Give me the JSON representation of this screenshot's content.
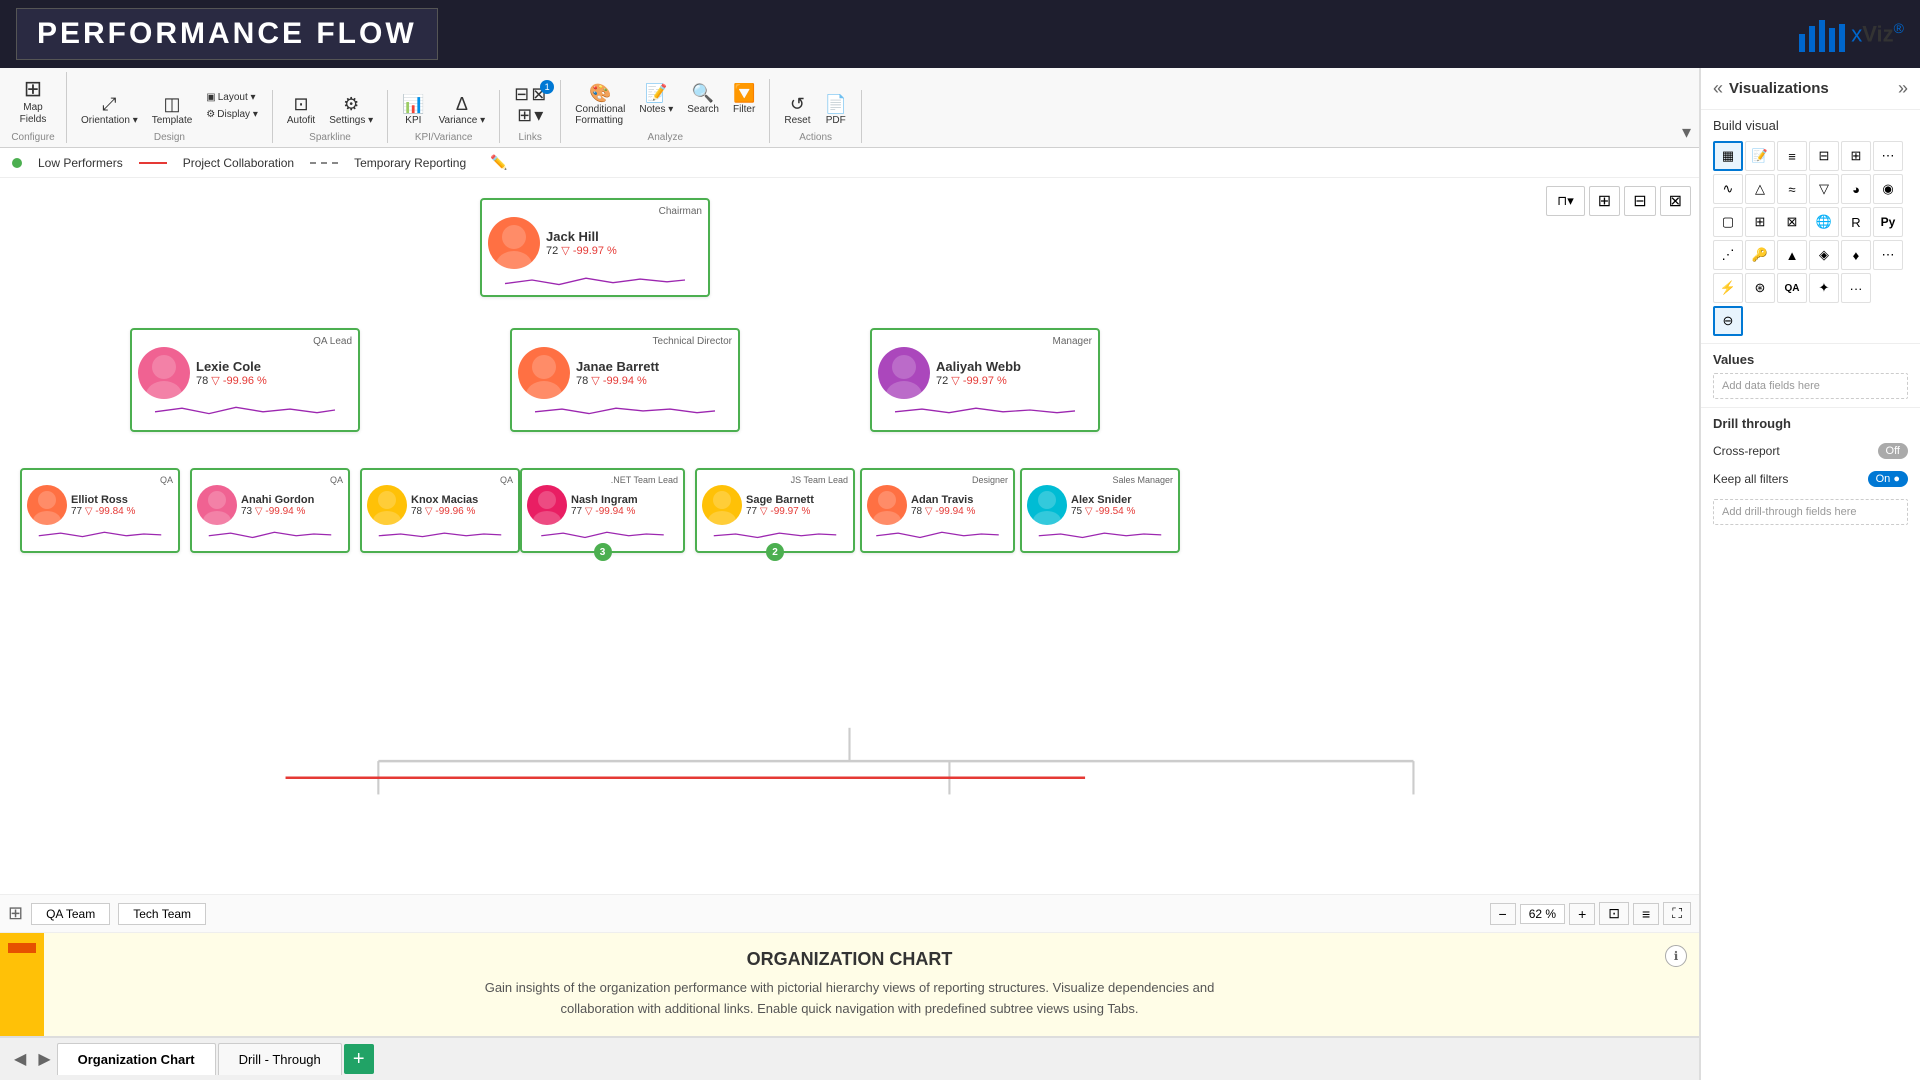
{
  "header": {
    "title": "PERFORMANCE FLOW"
  },
  "ribbon": {
    "groups": [
      {
        "label": "Configure",
        "items": [
          {
            "label": "Map Fields",
            "icon": "⊞"
          }
        ]
      },
      {
        "label": "Design",
        "items": [
          {
            "label": "Orientation",
            "icon": "⤢"
          },
          {
            "label": "Template",
            "icon": "◫"
          },
          {
            "label": "Layout",
            "icon": "▣"
          },
          {
            "label": "Display",
            "icon": "⚙"
          }
        ]
      },
      {
        "label": "Sparkline",
        "items": [
          {
            "label": "Autofit",
            "icon": "⊡"
          },
          {
            "label": "Settings",
            "icon": "⚙"
          }
        ]
      },
      {
        "label": "KPI/Variance",
        "items": [
          {
            "label": "KPI",
            "icon": "🔑"
          },
          {
            "label": "Variance",
            "icon": "Δ"
          }
        ]
      },
      {
        "label": "Links",
        "items": [
          {
            "label": "Links",
            "icon": "🔗",
            "badge": "1"
          }
        ]
      },
      {
        "label": "Analyze",
        "items": [
          {
            "label": "Conditional Formatting",
            "icon": "🎨"
          },
          {
            "label": "Notes",
            "icon": "📝"
          },
          {
            "label": "Search",
            "icon": "🔍"
          },
          {
            "label": "Filter",
            "icon": "🔽"
          }
        ]
      },
      {
        "label": "Actions",
        "items": [
          {
            "label": "Reset",
            "icon": "↺"
          },
          {
            "label": "PDF",
            "icon": "📄"
          }
        ]
      }
    ]
  },
  "legend": {
    "items": [
      {
        "type": "dot",
        "color": "#4caf50",
        "label": "Low Performers"
      },
      {
        "type": "line",
        "color": "#e53935",
        "label": "Project Collaboration"
      },
      {
        "type": "dashed",
        "color": "#888",
        "label": "Temporary Reporting"
      }
    ]
  },
  "nodes": {
    "chairman": {
      "role": "Chairman",
      "name": "Jack Hill",
      "value": "72",
      "variance": "▽ -99.97 %",
      "avatar_color": "av-orange",
      "avatar_emoji": "👤"
    },
    "qa_lead": {
      "role": "QA Lead",
      "name": "Lexie Cole",
      "value": "78",
      "variance": "▽ -99.96 %",
      "avatar_color": "av-pink",
      "avatar_emoji": "👤"
    },
    "tech_dir": {
      "role": "Technical Director",
      "name": "Janae Barrett",
      "value": "78",
      "variance": "▽ -99.94 %",
      "avatar_color": "av-orange",
      "avatar_emoji": "👤"
    },
    "manager": {
      "role": "Manager",
      "name": "Aaliyah Webb",
      "value": "72",
      "variance": "▽ -99.97 %",
      "avatar_color": "av-purple",
      "avatar_emoji": "👤"
    },
    "elliot": {
      "role": "QA",
      "name": "Elliot Ross",
      "value": "77",
      "variance": "▽ -99.84 %",
      "avatar_color": "av-orange",
      "avatar_emoji": "👤"
    },
    "anahi": {
      "role": "QA",
      "name": "Anahi Gordon",
      "value": "73",
      "variance": "▽ -99.94 %",
      "avatar_color": "av-pink",
      "avatar_emoji": "👤"
    },
    "knox": {
      "role": "QA",
      "name": "Knox Macias",
      "value": "78",
      "variance": "▽ -99.96 %",
      "avatar_color": "av-yellow",
      "avatar_emoji": "👤"
    },
    "nash": {
      "role": ".NET Team Lead",
      "name": "Nash Ingram",
      "value": "77",
      "variance": "▽ -99.94 %",
      "avatar_color": "av-pink",
      "avatar_emoji": "👤"
    },
    "sage": {
      "role": "JS Team Lead",
      "name": "Sage Barnett",
      "value": "77",
      "variance": "▽ -99.97 %",
      "avatar_color": "av-yellow",
      "avatar_emoji": "👤"
    },
    "adan": {
      "role": "Designer",
      "name": "Adan Travis",
      "value": "78",
      "variance": "▽ -99.94 %",
      "avatar_color": "av-orange",
      "avatar_emoji": "👤"
    },
    "alex": {
      "role": "Sales Manager",
      "name": "Alex Snider",
      "value": "75",
      "variance": "▽ -99.54 %",
      "avatar_color": "av-teal",
      "avatar_emoji": "👤"
    }
  },
  "chart_bottom": {
    "teams": [
      "QA Team",
      "Tech Team"
    ],
    "zoom": "62 %"
  },
  "info_panel": {
    "title": "ORGANIZATION CHART",
    "description": "Gain insights of the organization performance with pictorial hierarchy views of reporting structures. Visualize dependencies and collaboration with additional links. Enable quick navigation with predefined subtree views using Tabs."
  },
  "tabs": [
    {
      "label": "Organization Chart",
      "active": true
    },
    {
      "label": "Drill - Through",
      "active": false
    }
  ],
  "right_panel": {
    "title": "Visualizations",
    "build_visual_label": "Build visual",
    "values_section": {
      "title": "Values",
      "placeholder": "Add data fields here"
    },
    "drill_section": {
      "title": "Drill through",
      "cross_report": {
        "label": "Cross-report",
        "state": "Off"
      },
      "keep_filters": {
        "label": "Keep all filters",
        "state": "On"
      },
      "placeholder": "Add drill-through fields here"
    }
  }
}
